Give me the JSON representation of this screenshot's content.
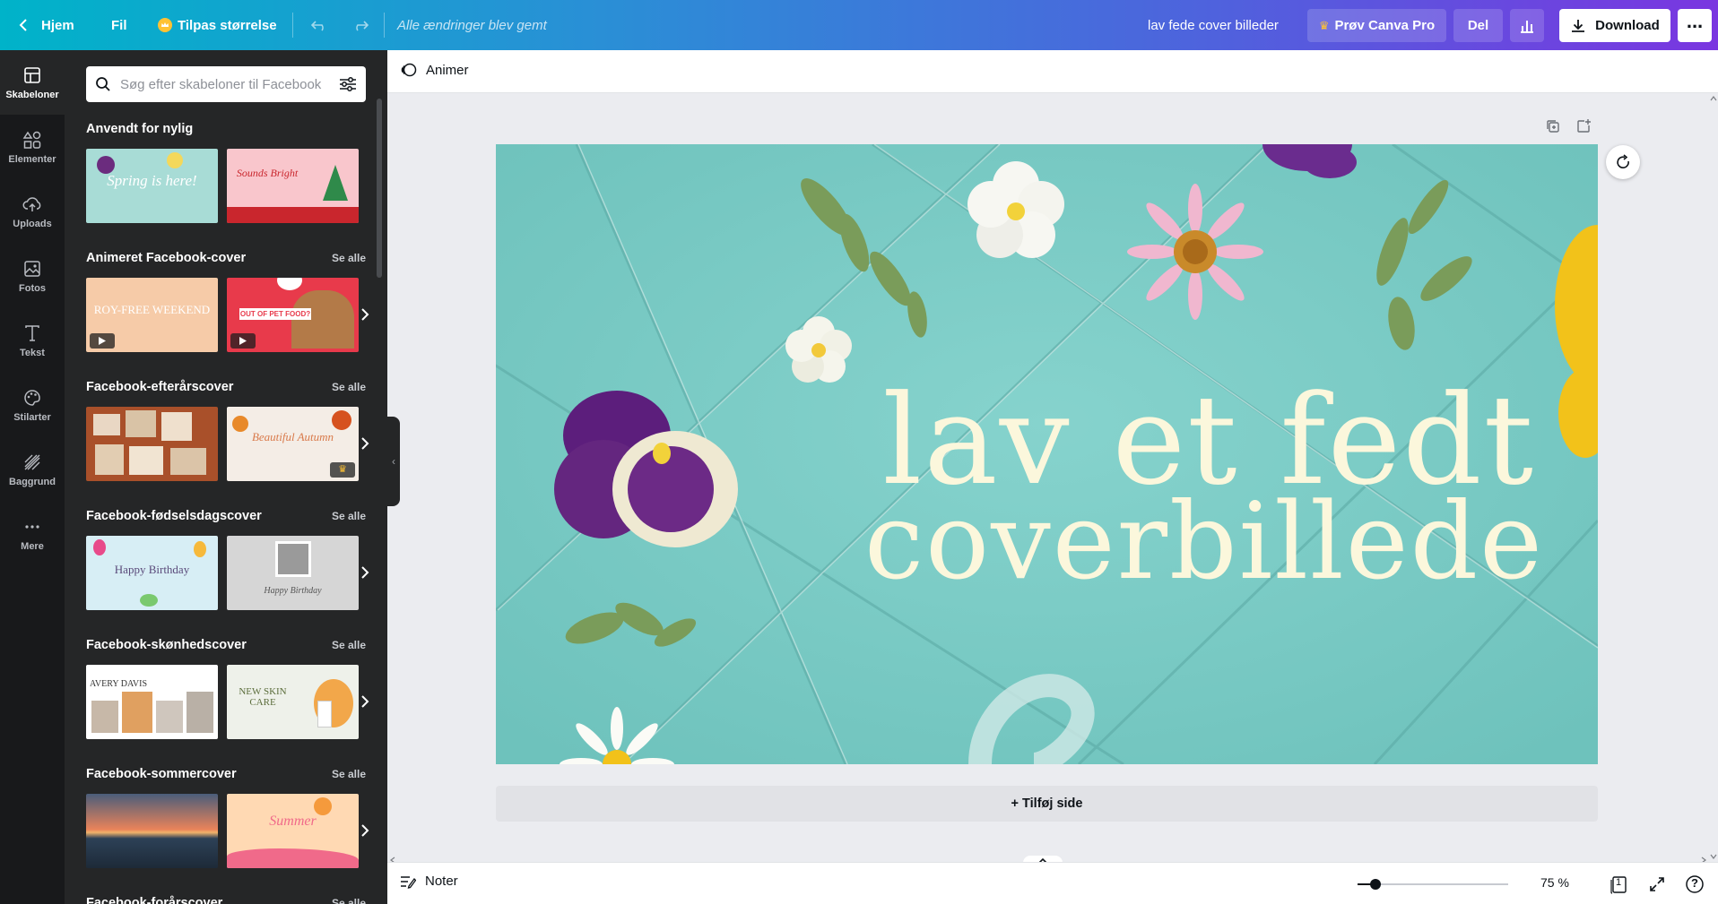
{
  "topbar": {
    "back_label": "Hjem",
    "file_label": "Fil",
    "resize_label": "Tilpas størrelse",
    "saved_status": "Alle ændringer blev gemt",
    "doc_title": "lav fede cover billeder",
    "pro_label": "Prøv Canva Pro",
    "share_label": "Del",
    "download_label": "Download"
  },
  "rail": {
    "items": [
      {
        "label": "Skabeloner",
        "icon": "templates-icon"
      },
      {
        "label": "Elementer",
        "icon": "elements-icon"
      },
      {
        "label": "Uploads",
        "icon": "upload-cloud-icon"
      },
      {
        "label": "Fotos",
        "icon": "photo-icon"
      },
      {
        "label": "Tekst",
        "icon": "text-icon"
      },
      {
        "label": "Stilarter",
        "icon": "palette-icon"
      },
      {
        "label": "Baggrund",
        "icon": "background-pattern-icon"
      },
      {
        "label": "Mere",
        "icon": "more-dots-icon"
      }
    ]
  },
  "panel": {
    "search_placeholder": "Søg efter skabeloner til Facebook",
    "see_all": "Se alle",
    "sections": [
      {
        "title": "Anvendt for nylig",
        "thumbs": [
          {
            "text": "Spring is here!",
            "color": "#a8dcd6"
          },
          {
            "text": "Sounds Bright",
            "color": "#f9c6cc"
          }
        ]
      },
      {
        "title": "Animeret Facebook-cover",
        "thumbs": [
          {
            "text": "ROY-FREE WEEKEND",
            "color": "#f6cba8"
          },
          {
            "text": "OUT OF PET FOOD?",
            "color": "#e83a4b"
          }
        ]
      },
      {
        "title": "Facebook-efterårscover",
        "thumbs": [
          {
            "text": "",
            "color": "#a9502a"
          },
          {
            "text": "Beautiful Autumn",
            "color": "#f4ede6"
          }
        ]
      },
      {
        "title": "Facebook-fødselsdagscover",
        "thumbs": [
          {
            "text": "Happy Birthday",
            "color": "#d7eef5"
          },
          {
            "text": "Happy Birthday",
            "color": "#d6d6d6"
          }
        ]
      },
      {
        "title": "Facebook-skønhedscover",
        "thumbs": [
          {
            "text": "AVERY DAVIS",
            "color": "#ffffff"
          },
          {
            "text": "NEW SKIN CARE",
            "color": "#eef1ea"
          }
        ]
      },
      {
        "title": "Facebook-sommercover",
        "thumbs": [
          {
            "text": "",
            "color": "#2d4157"
          },
          {
            "text": "Summer",
            "color": "#ffd9b3"
          }
        ]
      },
      {
        "title": "Facebook-forårscover",
        "thumbs": []
      }
    ]
  },
  "editor": {
    "animate_label": "Animer",
    "headline_line1": "lav et fedt",
    "headline_line2": "coverbillede",
    "add_page_label": "+ Tilføj side",
    "notes_label": "Noter",
    "zoom": "75 %",
    "zoom_fraction": 0.12,
    "page_count": "1",
    "help_label": "?"
  },
  "colors": {
    "canvas_bg": "#7ecdc7",
    "headline": "#fbf7dc",
    "panel_bg": "#252627",
    "rail_bg": "#18191b"
  }
}
